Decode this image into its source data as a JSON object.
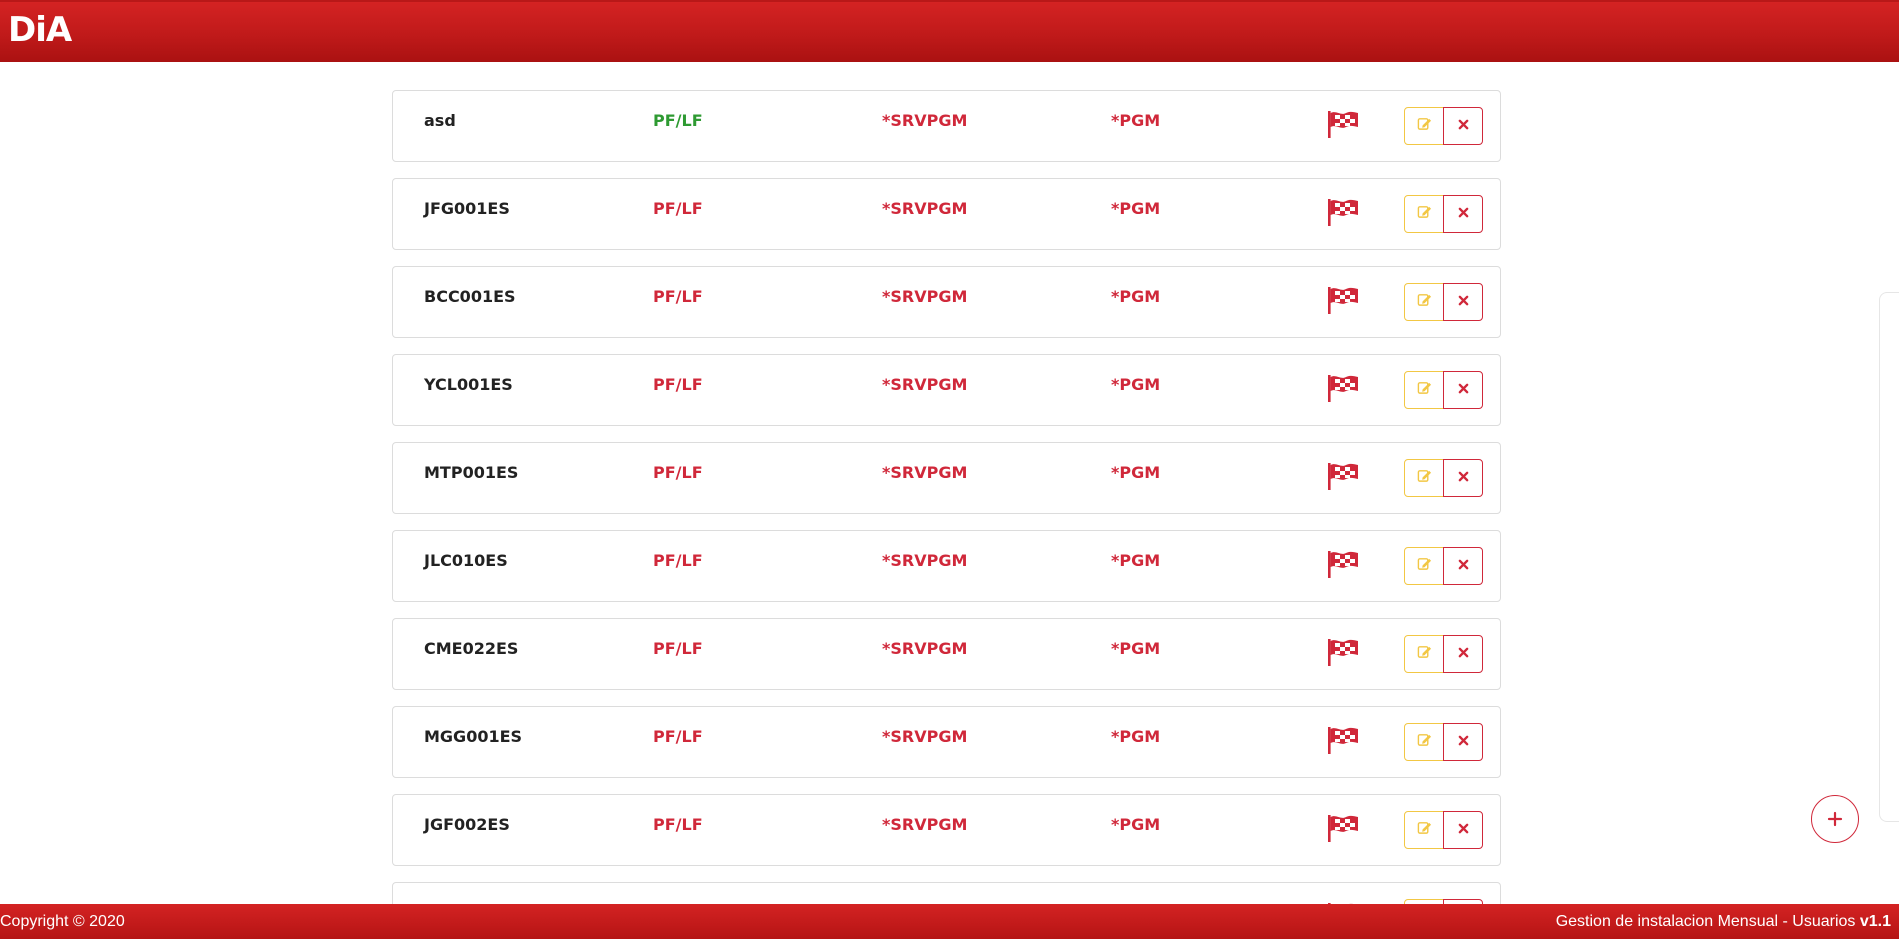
{
  "header": {
    "logo_text": "DiA"
  },
  "rows": [
    {
      "user": "asd",
      "library": "PF/LF",
      "type": "*SRVPGM",
      "object": "*PGM",
      "library_color": "green"
    },
    {
      "user": "JFG001ES",
      "library": "PF/LF",
      "type": "*SRVPGM",
      "object": "*PGM",
      "library_color": "red"
    },
    {
      "user": "BCC001ES",
      "library": "PF/LF",
      "type": "*SRVPGM",
      "object": "*PGM",
      "library_color": "red"
    },
    {
      "user": "YCL001ES",
      "library": "PF/LF",
      "type": "*SRVPGM",
      "object": "*PGM",
      "library_color": "red"
    },
    {
      "user": "MTP001ES",
      "library": "PF/LF",
      "type": "*SRVPGM",
      "object": "*PGM",
      "library_color": "red"
    },
    {
      "user": "JLC010ES",
      "library": "PF/LF",
      "type": "*SRVPGM",
      "object": "*PGM",
      "library_color": "red"
    },
    {
      "user": "CME022ES",
      "library": "PF/LF",
      "type": "*SRVPGM",
      "object": "*PGM",
      "library_color": "red"
    },
    {
      "user": "MGG001ES",
      "library": "PF/LF",
      "type": "*SRVPGM",
      "object": "*PGM",
      "library_color": "red"
    },
    {
      "user": "JGF002ES",
      "library": "PF/LF",
      "type": "*SRVPGM",
      "object": "*PGM",
      "library_color": "red"
    },
    {
      "user": "",
      "library": "",
      "type": "",
      "object": "",
      "library_color": "red"
    }
  ],
  "icons": {
    "flag": "checkered-flag-icon",
    "edit": "pencil-edit-icon",
    "delete": "close-x-icon",
    "add": "plus-icon"
  },
  "colors": {
    "brand_red": "#c41d1d",
    "text_red": "#d0283a",
    "text_green": "#2e9a32",
    "edit_yellow": "#f2c744"
  },
  "footer": {
    "copyright": "Copyright © 2020",
    "app_title": "Gestion de instalacion Mensual - Usuarios",
    "version": "v1.1"
  }
}
